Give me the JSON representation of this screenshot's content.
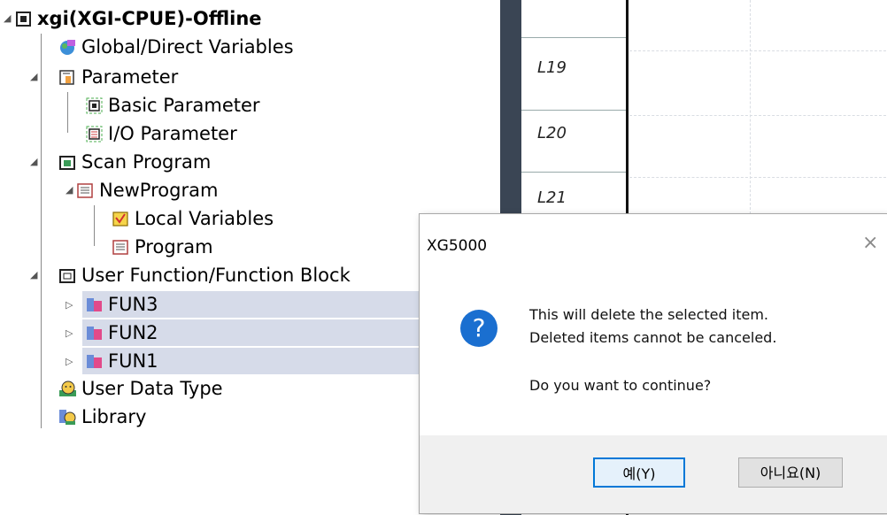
{
  "tree": {
    "root": "xgi(XGI-CPUE)-Offline",
    "global_vars": "Global/Direct Variables",
    "parameter": "Parameter",
    "basic_param": "Basic Parameter",
    "io_param": "I/O Parameter",
    "scan_program": "Scan Program",
    "new_program": "NewProgram",
    "local_vars": "Local Variables",
    "program": "Program",
    "user_fb": "User Function/Function Block",
    "fun3": "FUN3",
    "fun2": "FUN2",
    "fun1": "FUN1",
    "user_data_type": "User Data Type",
    "library": "Library"
  },
  "ladder": {
    "rungs": [
      "L19",
      "L20",
      "L21"
    ]
  },
  "dialog": {
    "title": "XG5000",
    "close": "×",
    "icon": "question-icon",
    "line1": "This will delete the selected item.",
    "line2": "Deleted items cannot be canceled.",
    "line3": "Do you want to continue?",
    "yes": "예(Y)",
    "no": "아니요(N)"
  },
  "colors": {
    "selection": "#d6dbe9",
    "gutter": "#3a4554",
    "question_icon": "#1a6fd0",
    "default_button_border": "#0078d7"
  }
}
